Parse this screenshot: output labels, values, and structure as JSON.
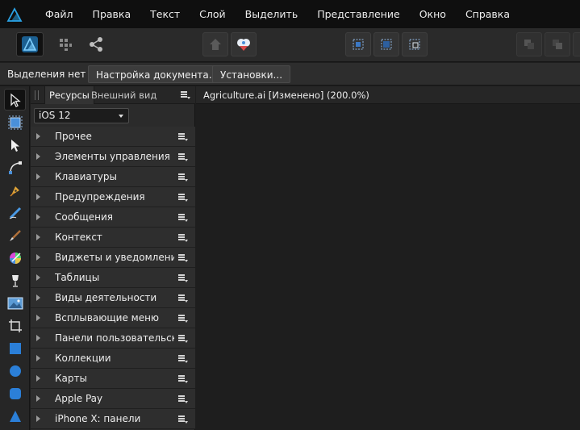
{
  "menubar": {
    "items": [
      "Файл",
      "Правка",
      "Текст",
      "Слой",
      "Выделить",
      "Представление",
      "Окно",
      "Справка"
    ]
  },
  "contextbar": {
    "selection_status": "Выделения нет",
    "document_setup_label": "Настройка документа...",
    "preferences_label": "Установки..."
  },
  "panel": {
    "tabs": [
      "Ресурсы",
      "Внешний вид"
    ],
    "platform": "iOS 12",
    "categories": [
      "Прочее",
      "Элементы управления",
      "Клавиатуры",
      "Предупреждения",
      "Сообщения",
      "Контекст",
      "Виджеты и уведомления",
      "Таблицы",
      "Виды деятельности",
      "Всплывающие меню",
      "Панели пользовательского",
      "Коллекции",
      "Карты",
      "Apple Pay",
      "iPhone X: панели"
    ]
  },
  "document": {
    "tab_title": "Agriculture.ai [Изменено] (200.0%)"
  },
  "colors": {
    "accent_blue": "#2aa3e6",
    "menubar_bg": "#0f0f0f",
    "toolbar_bg": "#2a2a2a",
    "canvas_bg": "#1e1e1e"
  }
}
